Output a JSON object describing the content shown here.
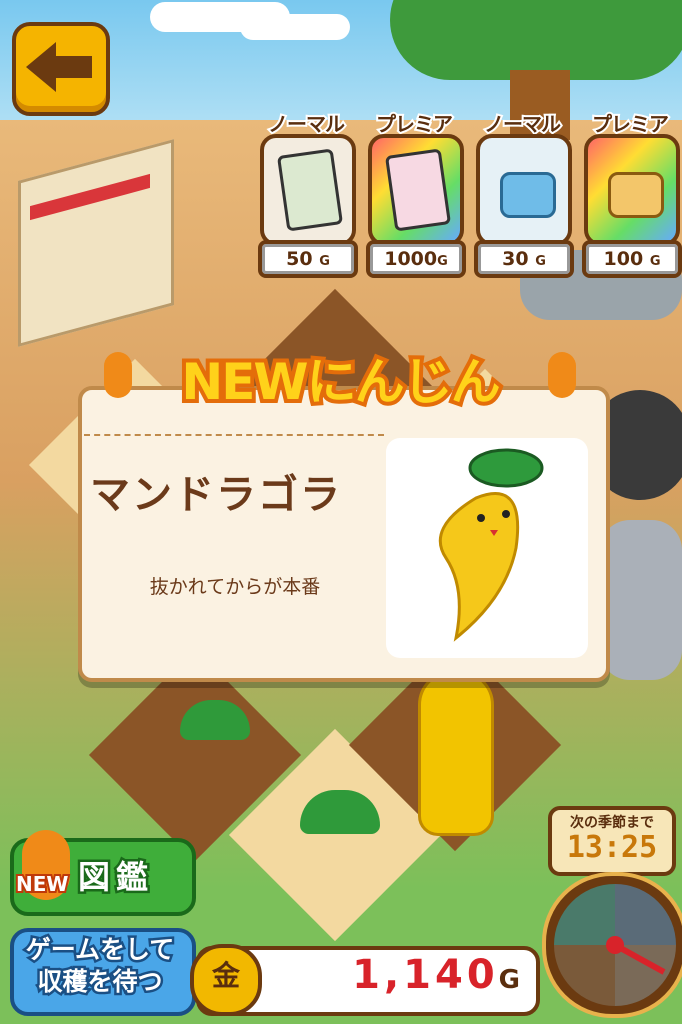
{
  "back_button": {
    "icon": "left-arrow-icon"
  },
  "shop": {
    "items": [
      {
        "label": "ノーマル",
        "price": "50",
        "icon": "seed-packet-icon"
      },
      {
        "label": "プレミア",
        "price": "1000",
        "icon": "premium-seed-packet-icon"
      },
      {
        "label": "ノーマル",
        "price": "30",
        "icon": "watering-can-icon"
      },
      {
        "label": "プレミア",
        "price": "100",
        "icon": "premium-watering-can-icon"
      }
    ],
    "currency": "G"
  },
  "popup": {
    "title": "NEWにんじん",
    "name": "マンドラゴラ",
    "description": "抜かれてからが本番",
    "image": "mandragora-carrot-image"
  },
  "zukan_button": {
    "new_label": "NEW",
    "label": "図鑑"
  },
  "game_button": {
    "line1": "ゲームをして",
    "line2": "収穫を待つ"
  },
  "gold": {
    "icon_text": "金",
    "value": "1,140",
    "unit": "G"
  },
  "season_timer": {
    "label": "次の季節まで",
    "time": "13:25"
  },
  "colors": {
    "accent_orange": "#e46d0a",
    "gold_red": "#d8232a",
    "frame_brown": "#6b3a10"
  }
}
